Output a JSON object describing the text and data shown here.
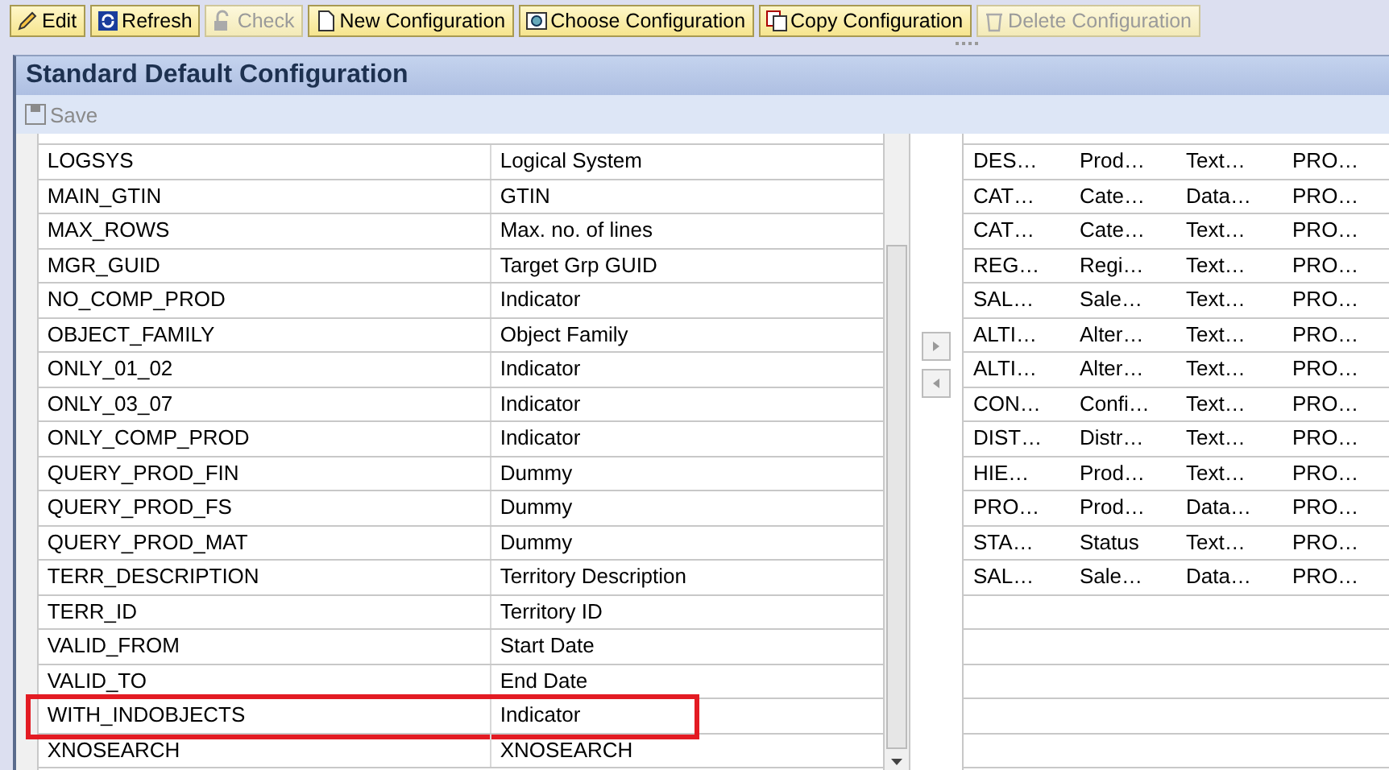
{
  "toolbar": [
    {
      "label": "Edit",
      "disabled": false
    },
    {
      "label": "Refresh",
      "disabled": false
    },
    {
      "label": "Check",
      "disabled": true
    },
    {
      "label": "New Configuration",
      "disabled": false
    },
    {
      "label": "Choose Configuration",
      "disabled": false
    },
    {
      "label": "Copy Configuration",
      "disabled": false
    },
    {
      "label": "Delete Configuration",
      "disabled": true
    }
  ],
  "panel": {
    "title": "Standard Default Configuration",
    "save": {
      "label": "Save",
      "disabled": true
    }
  },
  "left_table": {
    "rows": [
      {
        "field": "LOGSYS",
        "description": "Logical System",
        "highlighted": false
      },
      {
        "field": "MAIN_GTIN",
        "description": "GTIN",
        "highlighted": false
      },
      {
        "field": "MAX_ROWS",
        "description": "Max. no. of lines",
        "highlighted": false
      },
      {
        "field": "MGR_GUID",
        "description": "Target Grp GUID",
        "highlighted": false
      },
      {
        "field": "NO_COMP_PROD",
        "description": "Indicator",
        "highlighted": false
      },
      {
        "field": "OBJECT_FAMILY",
        "description": "Object Family",
        "highlighted": false
      },
      {
        "field": "ONLY_01_02",
        "description": "Indicator",
        "highlighted": false
      },
      {
        "field": "ONLY_03_07",
        "description": "Indicator",
        "highlighted": false
      },
      {
        "field": "ONLY_COMP_PROD",
        "description": "Indicator",
        "highlighted": false
      },
      {
        "field": "QUERY_PROD_FIN",
        "description": "Dummy",
        "highlighted": false
      },
      {
        "field": "QUERY_PROD_FS",
        "description": "Dummy",
        "highlighted": false
      },
      {
        "field": "QUERY_PROD_MAT",
        "description": "Dummy",
        "highlighted": false
      },
      {
        "field": "TERR_DESCRIPTION",
        "description": "Territory Description",
        "highlighted": false
      },
      {
        "field": "TERR_ID",
        "description": "Territory ID",
        "highlighted": false
      },
      {
        "field": "VALID_FROM",
        "description": "Start Date",
        "highlighted": false
      },
      {
        "field": "VALID_TO",
        "description": "End Date",
        "highlighted": false
      },
      {
        "field": "WITH_INDOBJECTS",
        "description": "Indicator",
        "highlighted": true
      },
      {
        "field": "XNOSEARCH",
        "description": "XNOSEARCH",
        "highlighted": false
      }
    ]
  },
  "right_table": {
    "rows": [
      [
        "DES…",
        "Prod…",
        "Text…",
        "PRO…"
      ],
      [
        "CAT…",
        "Cate…",
        "Data…",
        "PRO…"
      ],
      [
        "CAT…",
        "Cate…",
        "Text…",
        "PRO…"
      ],
      [
        "REG…",
        "Regi…",
        "Text…",
        "PRO…"
      ],
      [
        "SAL…",
        "Sale…",
        "Text…",
        "PRO…"
      ],
      [
        "ALTI…",
        "Alter…",
        "Text…",
        "PRO…"
      ],
      [
        "ALTI…",
        "Alter…",
        "Text…",
        "PRO…"
      ],
      [
        "CON…",
        "Confi…",
        "Text…",
        "PRO…"
      ],
      [
        "DIST…",
        "Distr…",
        "Text…",
        "PRO…"
      ],
      [
        "HIE…",
        "Prod…",
        "Text…",
        "PRO…"
      ],
      [
        "PRO…",
        "Prod…",
        "Data…",
        "PRO…"
      ],
      [
        "STA…",
        "Status",
        "Text…",
        "PRO…"
      ],
      [
        "SAL…",
        "Sale…",
        "Data…",
        "PRO…"
      ]
    ]
  }
}
